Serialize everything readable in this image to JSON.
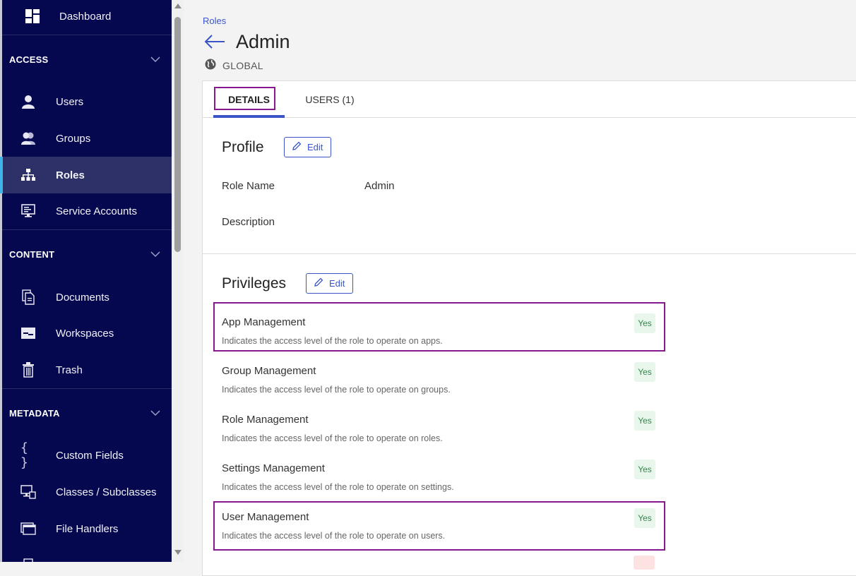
{
  "sidebar": {
    "dashboard": {
      "label": "Dashboard",
      "icon": "dashboard-icon"
    },
    "sections": [
      {
        "title": "ACCESS",
        "items": [
          {
            "label": "Users",
            "icon": "user-icon"
          },
          {
            "label": "Groups",
            "icon": "groups-icon"
          },
          {
            "label": "Roles",
            "icon": "roles-icon",
            "active": true
          },
          {
            "label": "Service Accounts",
            "icon": "service-accounts-icon"
          }
        ]
      },
      {
        "title": "CONTENT",
        "items": [
          {
            "label": "Documents",
            "icon": "documents-icon"
          },
          {
            "label": "Workspaces",
            "icon": "workspaces-icon"
          },
          {
            "label": "Trash",
            "icon": "trash-icon"
          }
        ]
      },
      {
        "title": "METADATA",
        "items": [
          {
            "label": "Custom Fields",
            "icon": "custom-fields-icon"
          },
          {
            "label": "Classes / Subclasses",
            "icon": "classes-icon"
          },
          {
            "label": "File Handlers",
            "icon": "file-handlers-icon"
          }
        ]
      }
    ]
  },
  "header": {
    "breadcrumb": "Roles",
    "title": "Admin",
    "scope": "GLOBAL"
  },
  "tabs": [
    {
      "label": "DETAILS",
      "active": true
    },
    {
      "label": "USERS (1)",
      "active": false
    }
  ],
  "profile": {
    "heading": "Profile",
    "edit_label": "Edit",
    "fields": [
      {
        "label": "Role Name",
        "value": "Admin"
      },
      {
        "label": "Description",
        "value": ""
      }
    ]
  },
  "privileges": {
    "heading": "Privileges",
    "edit_label": "Edit",
    "items": [
      {
        "name": "App Management",
        "description": "Indicates the access level of the role to operate on apps.",
        "value": "Yes",
        "highlighted": true
      },
      {
        "name": "Group Management",
        "description": "Indicates the access level of the role to operate on groups.",
        "value": "Yes",
        "highlighted": false
      },
      {
        "name": "Role Management",
        "description": "Indicates the access level of the role to operate on roles.",
        "value": "Yes",
        "highlighted": false
      },
      {
        "name": "Settings Management",
        "description": "Indicates the access level of the role to operate on settings.",
        "value": "Yes",
        "highlighted": false
      },
      {
        "name": "User Management",
        "description": "Indicates the access level of the role to operate on users.",
        "value": "Yes",
        "highlighted": true
      }
    ]
  },
  "colors": {
    "sidebar_bg": "#05084f",
    "accent": "#3b55c8",
    "highlight_box": "#86178d",
    "yes_badge_bg": "#e8f6ec",
    "yes_badge_text": "#2e8a4a"
  }
}
